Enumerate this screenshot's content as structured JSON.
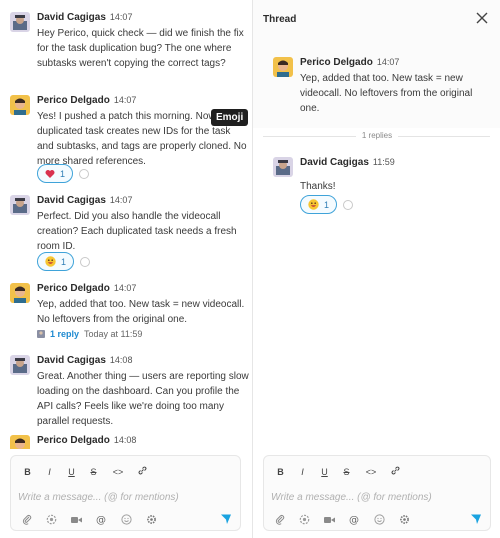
{
  "users": {
    "david": "David Cagigas",
    "perico": "Perico Delgado"
  },
  "left": {
    "messages": [
      {
        "author": "David Cagigas",
        "time": "14:07",
        "text": "Hey Perico, quick check — did we finish the fix for the task duplication bug? The one where subtasks weren't copying the correct tags?"
      },
      {
        "author": "Perico Delgado",
        "time": "14:07",
        "text": "Yes! I pushed a patch this morning. Now duplicated task creates new IDs for the task and subtasks, and tags are properly cloned. No more shared references.",
        "reaction": {
          "emoji": "heart",
          "count": "1"
        }
      },
      {
        "author": "David Cagigas",
        "time": "14:07",
        "text": "Perfect. Did you also handle the videocall creation? Each duplicated task needs a fresh room ID.",
        "reaction": {
          "emoji": "grin",
          "count": "1"
        }
      },
      {
        "author": "Perico Delgado",
        "time": "14:07",
        "text": "Yep, added that too. New task = new videocall. No leftovers from the original one.",
        "reply": {
          "label": "1 reply",
          "time": "Today at 11:59"
        }
      },
      {
        "author": "David Cagigas",
        "time": "14:08",
        "text": "Great. Another thing — users are reporting slow loading on the dashboard. Can you profile the API calls? Feels like we're doing too many parallel requests."
      },
      {
        "author": "Perico Delgado",
        "time": "14:08",
        "text": ""
      }
    ],
    "tooltip": "Emoji"
  },
  "thread": {
    "title": "Thread",
    "parent": {
      "author": "Perico Delgado",
      "time": "14:07",
      "text": "Yep, added that too. New task = new videocall. No leftovers from the original one."
    },
    "replies_label": "1 replies",
    "reply": {
      "author": "David Cagigas",
      "time": "11:59",
      "text": "Thanks!",
      "reaction": {
        "emoji": "grin",
        "count": "1"
      }
    }
  },
  "composer": {
    "placeholder": "Write a message... (@ for mentions)",
    "format": {
      "bold": "B",
      "italic": "I",
      "underline": "U",
      "strike": "S",
      "code": "<>"
    }
  },
  "colors": {
    "accent": "#1f8ad0",
    "pill_border": "#3fa3d9",
    "send": "#1aa3e0"
  }
}
